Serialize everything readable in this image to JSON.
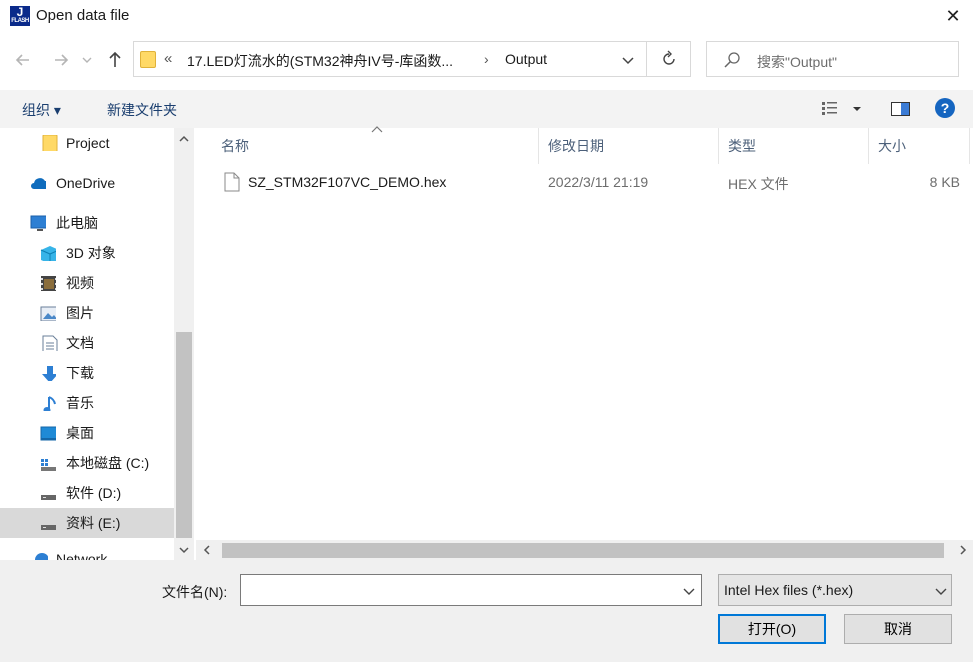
{
  "window": {
    "title": "Open data file",
    "app_icon_letter": "J",
    "app_icon_sub": "FLASH"
  },
  "address": {
    "overflow_label": "«",
    "breadcrumb": [
      "17.LED灯流水的(STM32神舟IV号-库函数...",
      "Output"
    ],
    "search_placeholder": "搜索\"Output\""
  },
  "toolbar": {
    "organize_label": "组织 ▾",
    "new_folder_label": "新建文件夹"
  },
  "nav": {
    "items": [
      {
        "label": "Project",
        "icon": "folder-icon"
      },
      {
        "label": "OneDrive",
        "icon": "cloud-icon"
      },
      {
        "label": "此电脑",
        "icon": "computer-icon"
      },
      {
        "label": "3D 对象",
        "icon": "cube-icon"
      },
      {
        "label": "视频",
        "icon": "video-icon"
      },
      {
        "label": "图片",
        "icon": "picture-icon"
      },
      {
        "label": "文档",
        "icon": "document-icon"
      },
      {
        "label": "下载",
        "icon": "download-icon"
      },
      {
        "label": "音乐",
        "icon": "music-icon"
      },
      {
        "label": "桌面",
        "icon": "desktop-icon"
      },
      {
        "label": "本地磁盘 (C:)",
        "icon": "drive-icon"
      },
      {
        "label": "软件 (D:)",
        "icon": "drive-icon"
      },
      {
        "label": "资料 (E:)",
        "icon": "drive-icon",
        "selected": true
      },
      {
        "label": "Network",
        "icon": "network-icon"
      }
    ]
  },
  "files": {
    "columns": [
      "名称",
      "修改日期",
      "类型",
      "大小"
    ],
    "rows": [
      {
        "name": "SZ_STM32F107VC_DEMO.hex",
        "modified": "2022/3/11 21:19",
        "type": "HEX 文件",
        "size": "8 KB"
      }
    ]
  },
  "bottom": {
    "filename_label": "文件名(N):",
    "filename_value": "",
    "filter_value": "Intel Hex files (*.hex)",
    "open_label": "打开(O)",
    "cancel_label": "取消"
  },
  "colors": {
    "accent": "#0078d7",
    "selected_bg": "#cce8ff",
    "nav_selected_bg": "#d9d9d9"
  }
}
